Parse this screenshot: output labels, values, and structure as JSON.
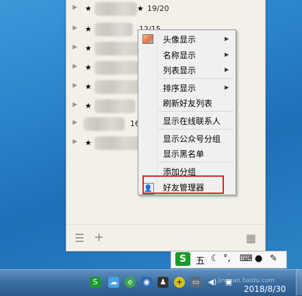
{
  "contact_groups": [
    {
      "count": "19/20"
    },
    {
      "count": "12/15"
    },
    {
      "count": ""
    },
    {
      "count": ""
    },
    {
      "count": ""
    },
    {
      "count": ""
    },
    {
      "count": "16"
    },
    {
      "count": ""
    }
  ],
  "context_menu": {
    "items": [
      {
        "label": "头像显示",
        "submenu": true
      },
      {
        "label": "名称显示",
        "submenu": true
      },
      {
        "label": "列表显示",
        "submenu": true
      },
      {
        "label": "排序显示",
        "submenu": true
      },
      {
        "label": "刷新好友列表",
        "submenu": false
      },
      {
        "label": "显示在线联系人",
        "submenu": false
      },
      {
        "label": "显示公众号分组",
        "submenu": false
      },
      {
        "label": "显示黑名单",
        "submenu": false
      },
      {
        "label": "添加分组",
        "submenu": false
      },
      {
        "label": "好友管理器",
        "submenu": false,
        "highlighted": true
      }
    ],
    "highlight_color": "#e02020"
  },
  "ime_bar": {
    "logo": "S",
    "mode": "五"
  },
  "taskbar": {
    "date": "2018/8/30",
    "watermark": "jingyan.baidu.com"
  },
  "colors": {
    "panel_bg": "#f3f0ea",
    "menu_bg": "#f0f0f0",
    "desktop_blue": "#2a82c9"
  }
}
